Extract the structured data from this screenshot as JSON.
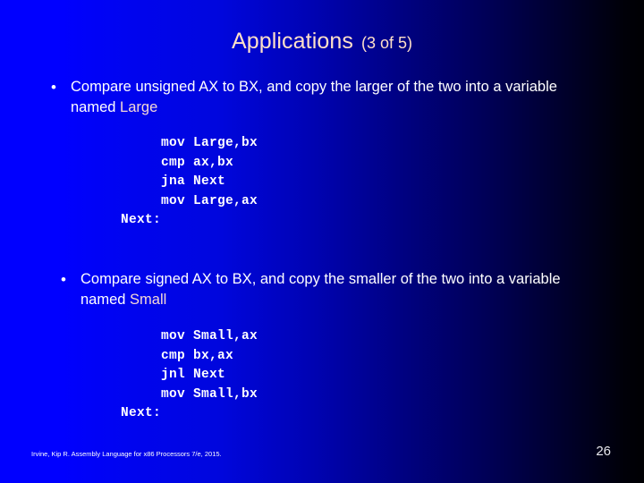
{
  "slide": {
    "title": {
      "main": "Applications",
      "sub": "(3 of 5)"
    },
    "bullets": [
      {
        "marker": "•",
        "text_before": "Compare unsigned AX to BX, and copy the larger of the two into a variable named ",
        "variable": "Large"
      },
      {
        "marker": "•",
        "text_before": "Compare signed AX to BX, and copy the smaller of the two into a variable named ",
        "variable": "Small"
      }
    ],
    "code_blocks": [
      {
        "lines": [
          "     mov Large,bx",
          "     cmp ax,bx",
          "     jna Next",
          "     mov Large,ax",
          "Next:"
        ],
        "text": "     mov Large,bx\n     cmp ax,bx\n     jna Next\n     mov Large,ax\nNext:"
      },
      {
        "lines": [
          "     mov Small,ax",
          "     cmp bx,ax",
          "     jnl Next",
          "     mov Small,bx",
          "Next:"
        ],
        "text": "     mov Small,ax\n     cmp bx,ax\n     jnl Next\n     mov Small,bx\nNext:"
      }
    ],
    "footer": {
      "credit": "Irvine, Kip R. Assembly Language for x86 Processors 7/e, 2015.",
      "page_number": "26"
    },
    "colors": {
      "title": "#ffe0c8",
      "body_text": "#ffffff",
      "variable_highlight": "#f4d8d6",
      "background_left": "#0000ff",
      "background_right": "#000003"
    }
  }
}
